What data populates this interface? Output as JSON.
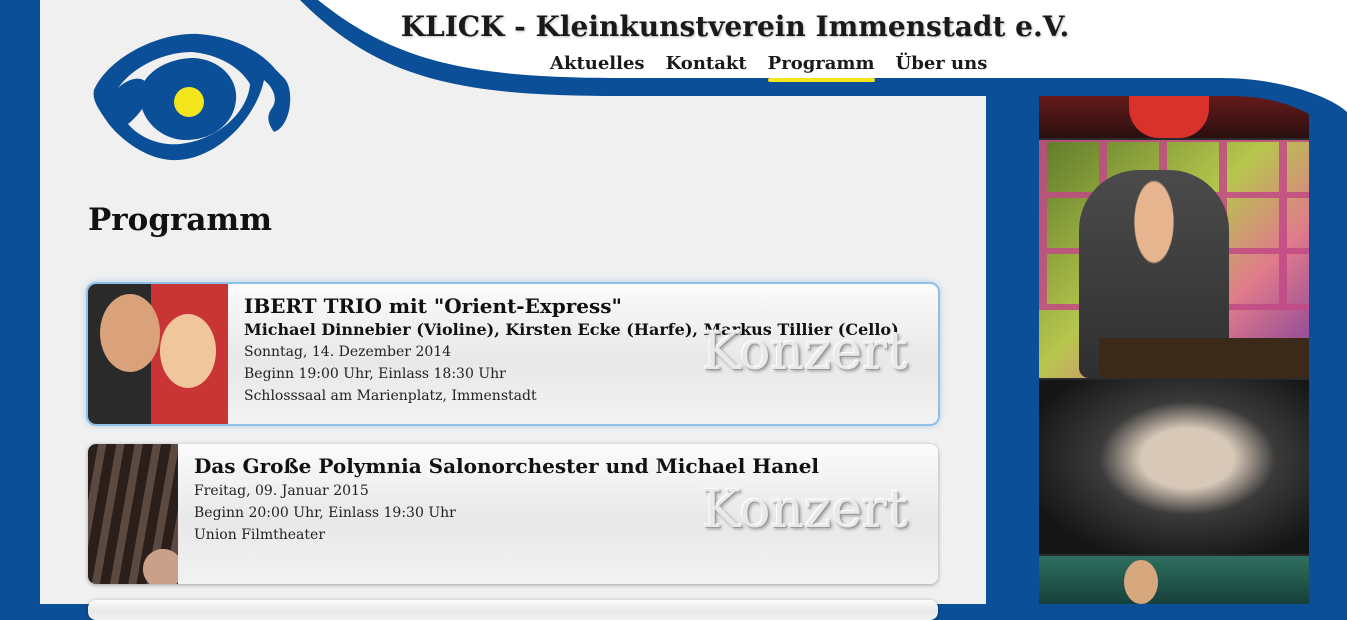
{
  "site": {
    "title": "KLICK - Kleinkunstverein Immenstadt e.V."
  },
  "nav": {
    "items": [
      {
        "label": "Aktuelles"
      },
      {
        "label": "Kontakt"
      },
      {
        "label": "Programm",
        "active": true
      },
      {
        "label": "Über uns"
      }
    ]
  },
  "colors": {
    "brand_blue": "#0b4f98",
    "accent_yellow": "#f3e41b",
    "panel_gray": "#f0f0f0"
  },
  "logo": {
    "icon": "eye-logo-icon"
  },
  "page": {
    "heading": "Programm"
  },
  "events": [
    {
      "title": "IBERT TRIO mit \"Orient-Express\"",
      "subtitle": "Michael Dinnebier (Violine), Kirsten Ecke (Harfe), Markus Tillier (Cello)",
      "date": "Sonntag, 14. Dezember 2014",
      "time": "Beginn 19:00 Uhr, Einlass 18:30 Uhr",
      "venue": "Schlosssaal am Marienplatz, Immenstadt",
      "category": "Konzert"
    },
    {
      "title": "Das Große Polymnia Salonorchester und Michael Hanel",
      "date": "Freitag, 09. Januar 2015",
      "time": "Beginn 20:00 Uhr, Einlass 19:30 Uhr",
      "venue": "Union Filmtheater",
      "category": "Konzert"
    }
  ]
}
